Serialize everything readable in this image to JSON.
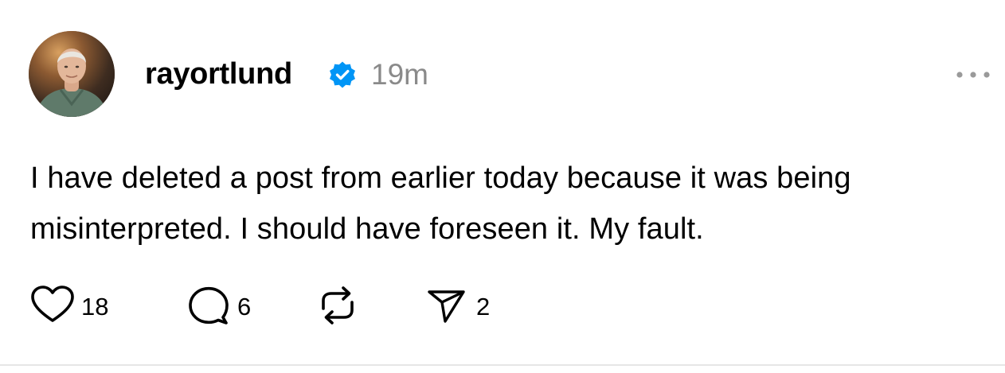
{
  "post": {
    "username": "rayortlund",
    "verified": true,
    "timestamp": "19m",
    "text": "I have deleted a post from earlier today because it was being misinterpreted. I should have foreseen it. My fault.",
    "actions": {
      "like_count": "18",
      "reply_count": "6",
      "repost_count": "",
      "share_count": "2"
    }
  },
  "colors": {
    "verified_badge": "#0095f6",
    "muted_text": "#8a8a8a",
    "text": "#000000"
  },
  "icons": [
    "more-icon",
    "verified-icon",
    "heart-icon",
    "comment-icon",
    "repost-icon",
    "share-icon"
  ]
}
